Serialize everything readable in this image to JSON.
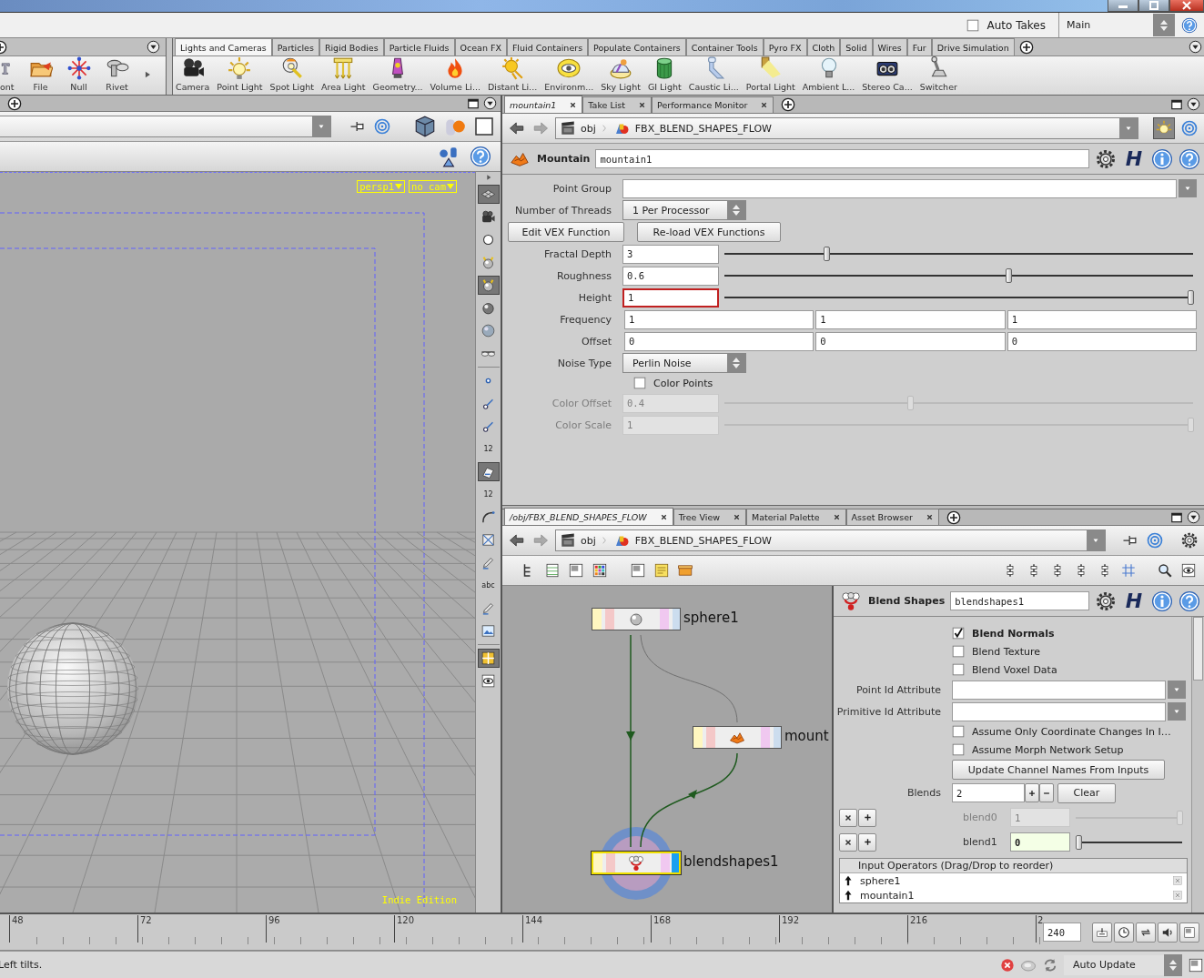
{
  "take_bar": {
    "auto_takes": {
      "label": "Auto Takes",
      "checked": false
    },
    "take": "Main"
  },
  "left_shelf": {
    "tools": [
      "ont",
      "File",
      "Null",
      "Rivet"
    ]
  },
  "shelf": {
    "tabs": [
      {
        "label": "Lights and Cameras",
        "selected": true
      },
      {
        "label": "Particles",
        "selected": false
      },
      {
        "label": "Rigid Bodies",
        "selected": false
      },
      {
        "label": "Particle Fluids",
        "selected": false
      },
      {
        "label": "Ocean FX",
        "selected": false
      },
      {
        "label": "Fluid Containers",
        "selected": false
      },
      {
        "label": "Populate Containers",
        "selected": false
      },
      {
        "label": "Container Tools",
        "selected": false
      },
      {
        "label": "Pyro FX",
        "selected": false
      },
      {
        "label": "Cloth",
        "selected": false
      },
      {
        "label": "Solid",
        "selected": false
      },
      {
        "label": "Wires",
        "selected": false
      },
      {
        "label": "Fur",
        "selected": false
      },
      {
        "label": "Drive Simulation",
        "selected": false
      }
    ],
    "tools": [
      "Camera",
      "Point Light",
      "Spot Light",
      "Area Light",
      "Geometry...",
      "Volume Li...",
      "Distant Li...",
      "Environm...",
      "Sky Light",
      "GI Light",
      "Caustic Li...",
      "Portal Light",
      "Ambient L...",
      "Stereo Ca...",
      "Switcher"
    ]
  },
  "viewport": {
    "camera": "persp1",
    "display_camera": "no cam",
    "edition": "Indie Edition",
    "tool_labels": [
      "12",
      "12",
      "abc"
    ]
  },
  "param_pane": {
    "tabs": [
      {
        "label": "mountain1",
        "selected": true
      },
      {
        "label": "Take List",
        "selected": false
      },
      {
        "label": "Performance Monitor",
        "selected": false
      }
    ],
    "path": [
      "obj",
      "FBX_BLEND_SHAPES_FLOW"
    ],
    "node_type": "Mountain",
    "node_name": "mountain1",
    "asset_label": "H",
    "params": [
      {
        "kind": "menu_field",
        "label": "Point Group"
      },
      {
        "kind": "menu",
        "label": "Number of Threads",
        "value": "1 Per Processor"
      },
      {
        "kind": "buttons",
        "buttons": [
          "Edit VEX Function",
          "Re-load VEX Functions"
        ]
      },
      {
        "kind": "slider",
        "label": "Fractal Depth",
        "value": "3",
        "level": 0.22,
        "highlighted": false,
        "disabled": false
      },
      {
        "kind": "slider",
        "label": "Roughness",
        "value": "0.6",
        "level": 0.61,
        "highlighted": false,
        "disabled": false
      },
      {
        "kind": "slider",
        "label": "Height",
        "value": "1",
        "level": 1,
        "highlighted": true,
        "disabled": false
      },
      {
        "kind": "vector",
        "label": "Frequency",
        "values": [
          "1",
          "1",
          "1"
        ]
      },
      {
        "kind": "vector",
        "label": "Offset",
        "values": [
          "0",
          "0",
          "0"
        ]
      },
      {
        "kind": "menu",
        "label": "Noise Type",
        "value": "Perlin Noise"
      },
      {
        "kind": "checkbox",
        "label": "Color Points",
        "checked": false
      },
      {
        "kind": "slider",
        "label": "Color Offset",
        "value": "0.4",
        "level": 0.4,
        "highlighted": false,
        "disabled": true
      },
      {
        "kind": "slider",
        "label": "Color Scale",
        "value": "1",
        "level": 1,
        "highlighted": false,
        "disabled": true
      }
    ]
  },
  "network_pane": {
    "tabs": [
      {
        "label": "/obj/FBX_BLEND_SHAPES_FLOW",
        "selected": true
      },
      {
        "label": "Tree View",
        "selected": false
      },
      {
        "label": "Material Palette",
        "selected": false
      },
      {
        "label": "Asset Browser",
        "selected": false
      }
    ],
    "path": [
      "obj",
      "FBX_BLEND_SHAPES_FLOW"
    ],
    "nodes": [
      {
        "name": "sphere1",
        "selected": false,
        "display": false
      },
      {
        "name": "mount",
        "selected": false,
        "display": false
      },
      {
        "name": "blendshapes1",
        "selected": true,
        "display": true
      }
    ],
    "parameters": {
      "node_type": "Blend Shapes",
      "node_name": "blendshapes1",
      "asset_label": "H",
      "params": [
        {
          "kind": "checkbox",
          "label": "Blend Normals",
          "checked": true
        },
        {
          "kind": "checkbox",
          "label": "Blend Texture",
          "checked": false
        },
        {
          "kind": "checkbox",
          "label": "Blend Voxel Data",
          "checked": false
        },
        {
          "kind": "menu_field",
          "label": "Point Id Attribute"
        },
        {
          "kind": "menu_field",
          "label": "Primitive Id Attribute"
        },
        {
          "kind": "checkbox",
          "label": "Assume Only Coordinate Changes In I…",
          "checked": false
        },
        {
          "kind": "checkbox",
          "label": "Assume Morph Network Setup",
          "checked": false
        },
        {
          "kind": "button",
          "label": "Update Channel Names From Inputs"
        },
        {
          "kind": "multiparm",
          "label": "Blends",
          "value": "2",
          "clear": "Clear"
        },
        {
          "kind": "blend",
          "label": "blend0",
          "value": "1",
          "level": 1,
          "disabled": true
        },
        {
          "kind": "blend",
          "label": "blend1",
          "value": "0",
          "level": 0,
          "disabled": false
        }
      ],
      "inputs": {
        "header": "Input Operators (Drag/Drop to reorder)",
        "rows": [
          "sphere1",
          "mountain1"
        ]
      }
    }
  },
  "timeline": {
    "ticks": [
      "48",
      "72",
      "96",
      "120",
      "144",
      "168",
      "192",
      "216",
      "2"
    ],
    "end_frame": "240"
  },
  "status_bar": {
    "message": "Left tilts.",
    "update_mode": "Auto Update"
  }
}
